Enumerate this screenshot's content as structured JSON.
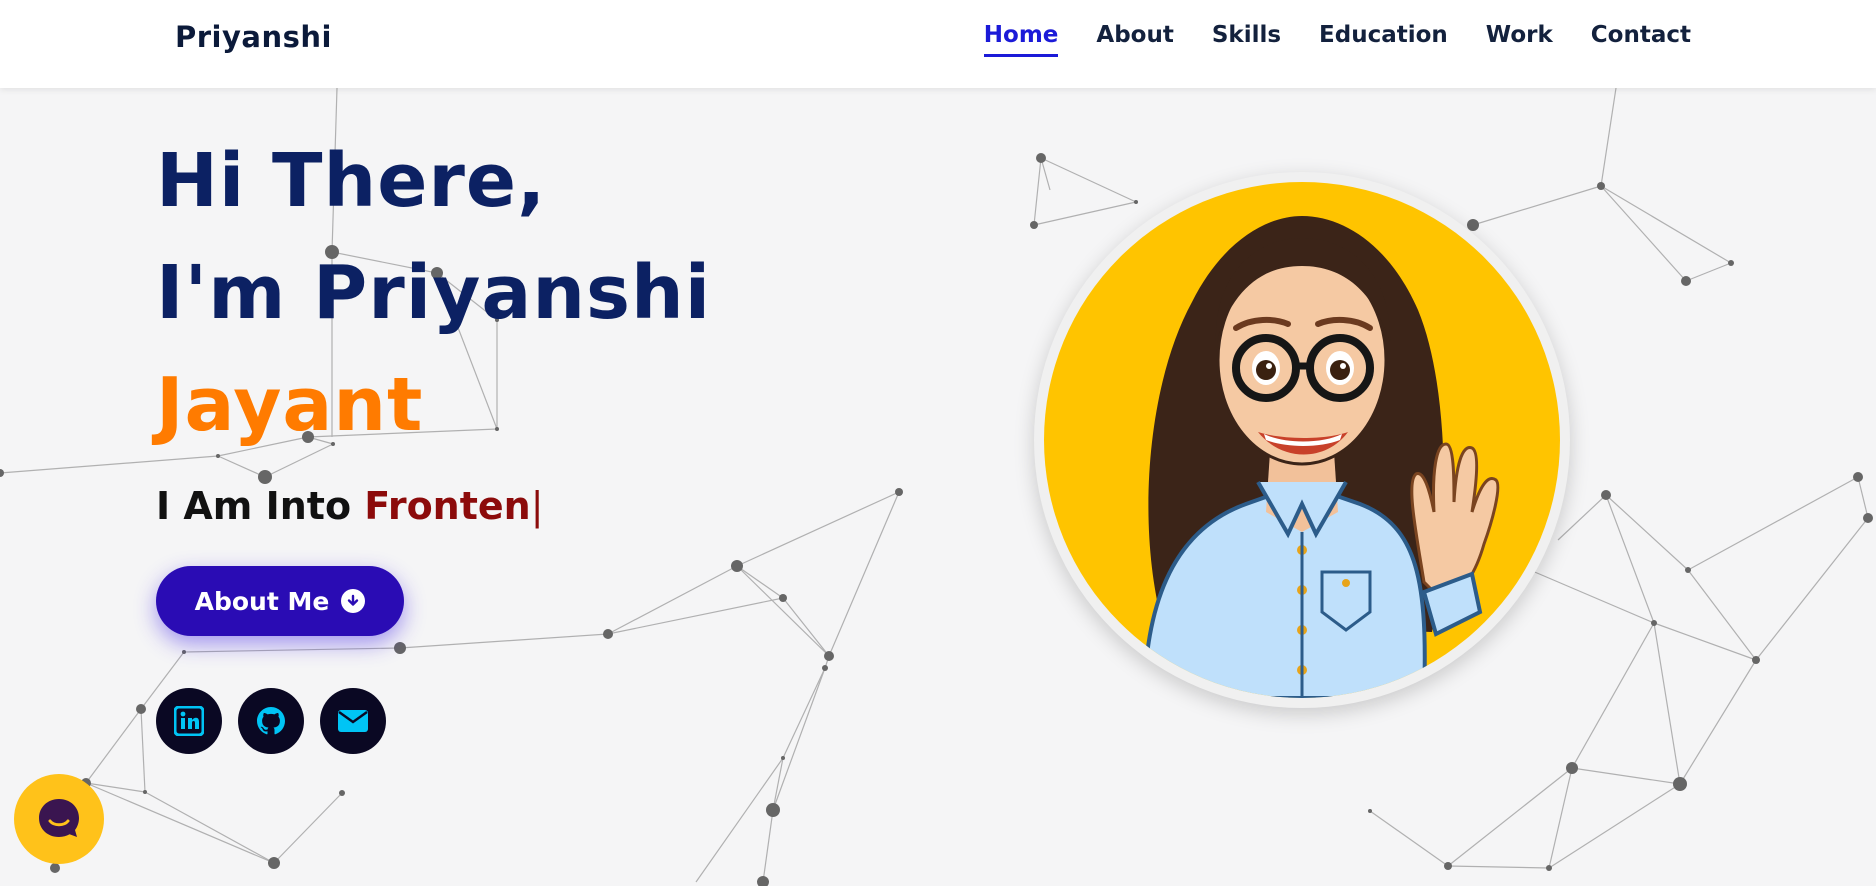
{
  "header": {
    "brand": "Priyanshi",
    "nav": [
      {
        "label": "Home",
        "active": true
      },
      {
        "label": "About"
      },
      {
        "label": "Skills"
      },
      {
        "label": "Education"
      },
      {
        "label": "Work"
      },
      {
        "label": "Contact"
      }
    ]
  },
  "hero": {
    "greeting": "Hi There,",
    "intro": "I'm Priyanshi",
    "surname": "Jayant",
    "typing_prefix": "I Am Into ",
    "typing_text": "Fronten",
    "typing_cursor": "|",
    "cta_label": "About Me",
    "cta_icon": "arrow-down-circle-icon",
    "socials": [
      {
        "icon": "linkedin-icon"
      },
      {
        "icon": "github-icon"
      },
      {
        "icon": "mail-icon"
      }
    ],
    "avatar": "cartoon-girl-avatar"
  },
  "chat_widget": {
    "icon": "chat-icon"
  },
  "colors": {
    "navy": "#0c2163",
    "accent_orange": "#ff7b00",
    "typed_red": "#8c0b0b",
    "button_blue": "#2a0cb4",
    "nav_active": "#1b1ad8",
    "avatar_bg": "#ffc400",
    "social_icon": "#00c4f5"
  }
}
